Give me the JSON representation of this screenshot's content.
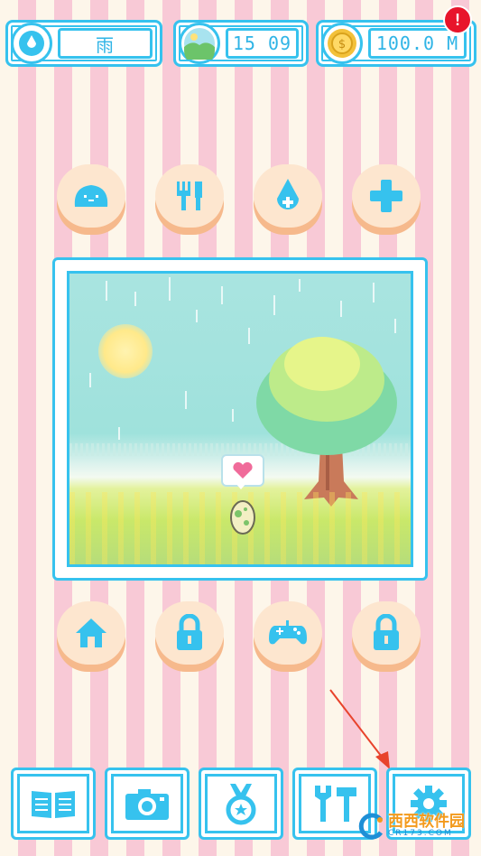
{
  "status": {
    "weather_label": "雨",
    "time": "15 09",
    "coins": "100.0 M",
    "alert_badge": "!"
  },
  "actions_top": [
    "slime-icon",
    "fork-knife-icon",
    "water-drop-icon",
    "plus-icon"
  ],
  "actions_bottom": [
    "house-icon",
    "lock-icon",
    "gamepad-icon",
    "lock-icon"
  ],
  "menu": [
    "book-icon",
    "camera-icon",
    "medal-icon",
    "tools-icon",
    "gear-icon"
  ],
  "watermark": {
    "brand": "西西软件园",
    "site": "CR173.COM"
  },
  "colors": {
    "accent": "#36c2ee",
    "button_face": "#fde6cf",
    "button_shadow": "#f6b98c",
    "stripe_pink": "#f8c9d6",
    "stripe_cream": "#fdf6ea",
    "heart": "#f06b9a",
    "alert": "#e8152b"
  }
}
